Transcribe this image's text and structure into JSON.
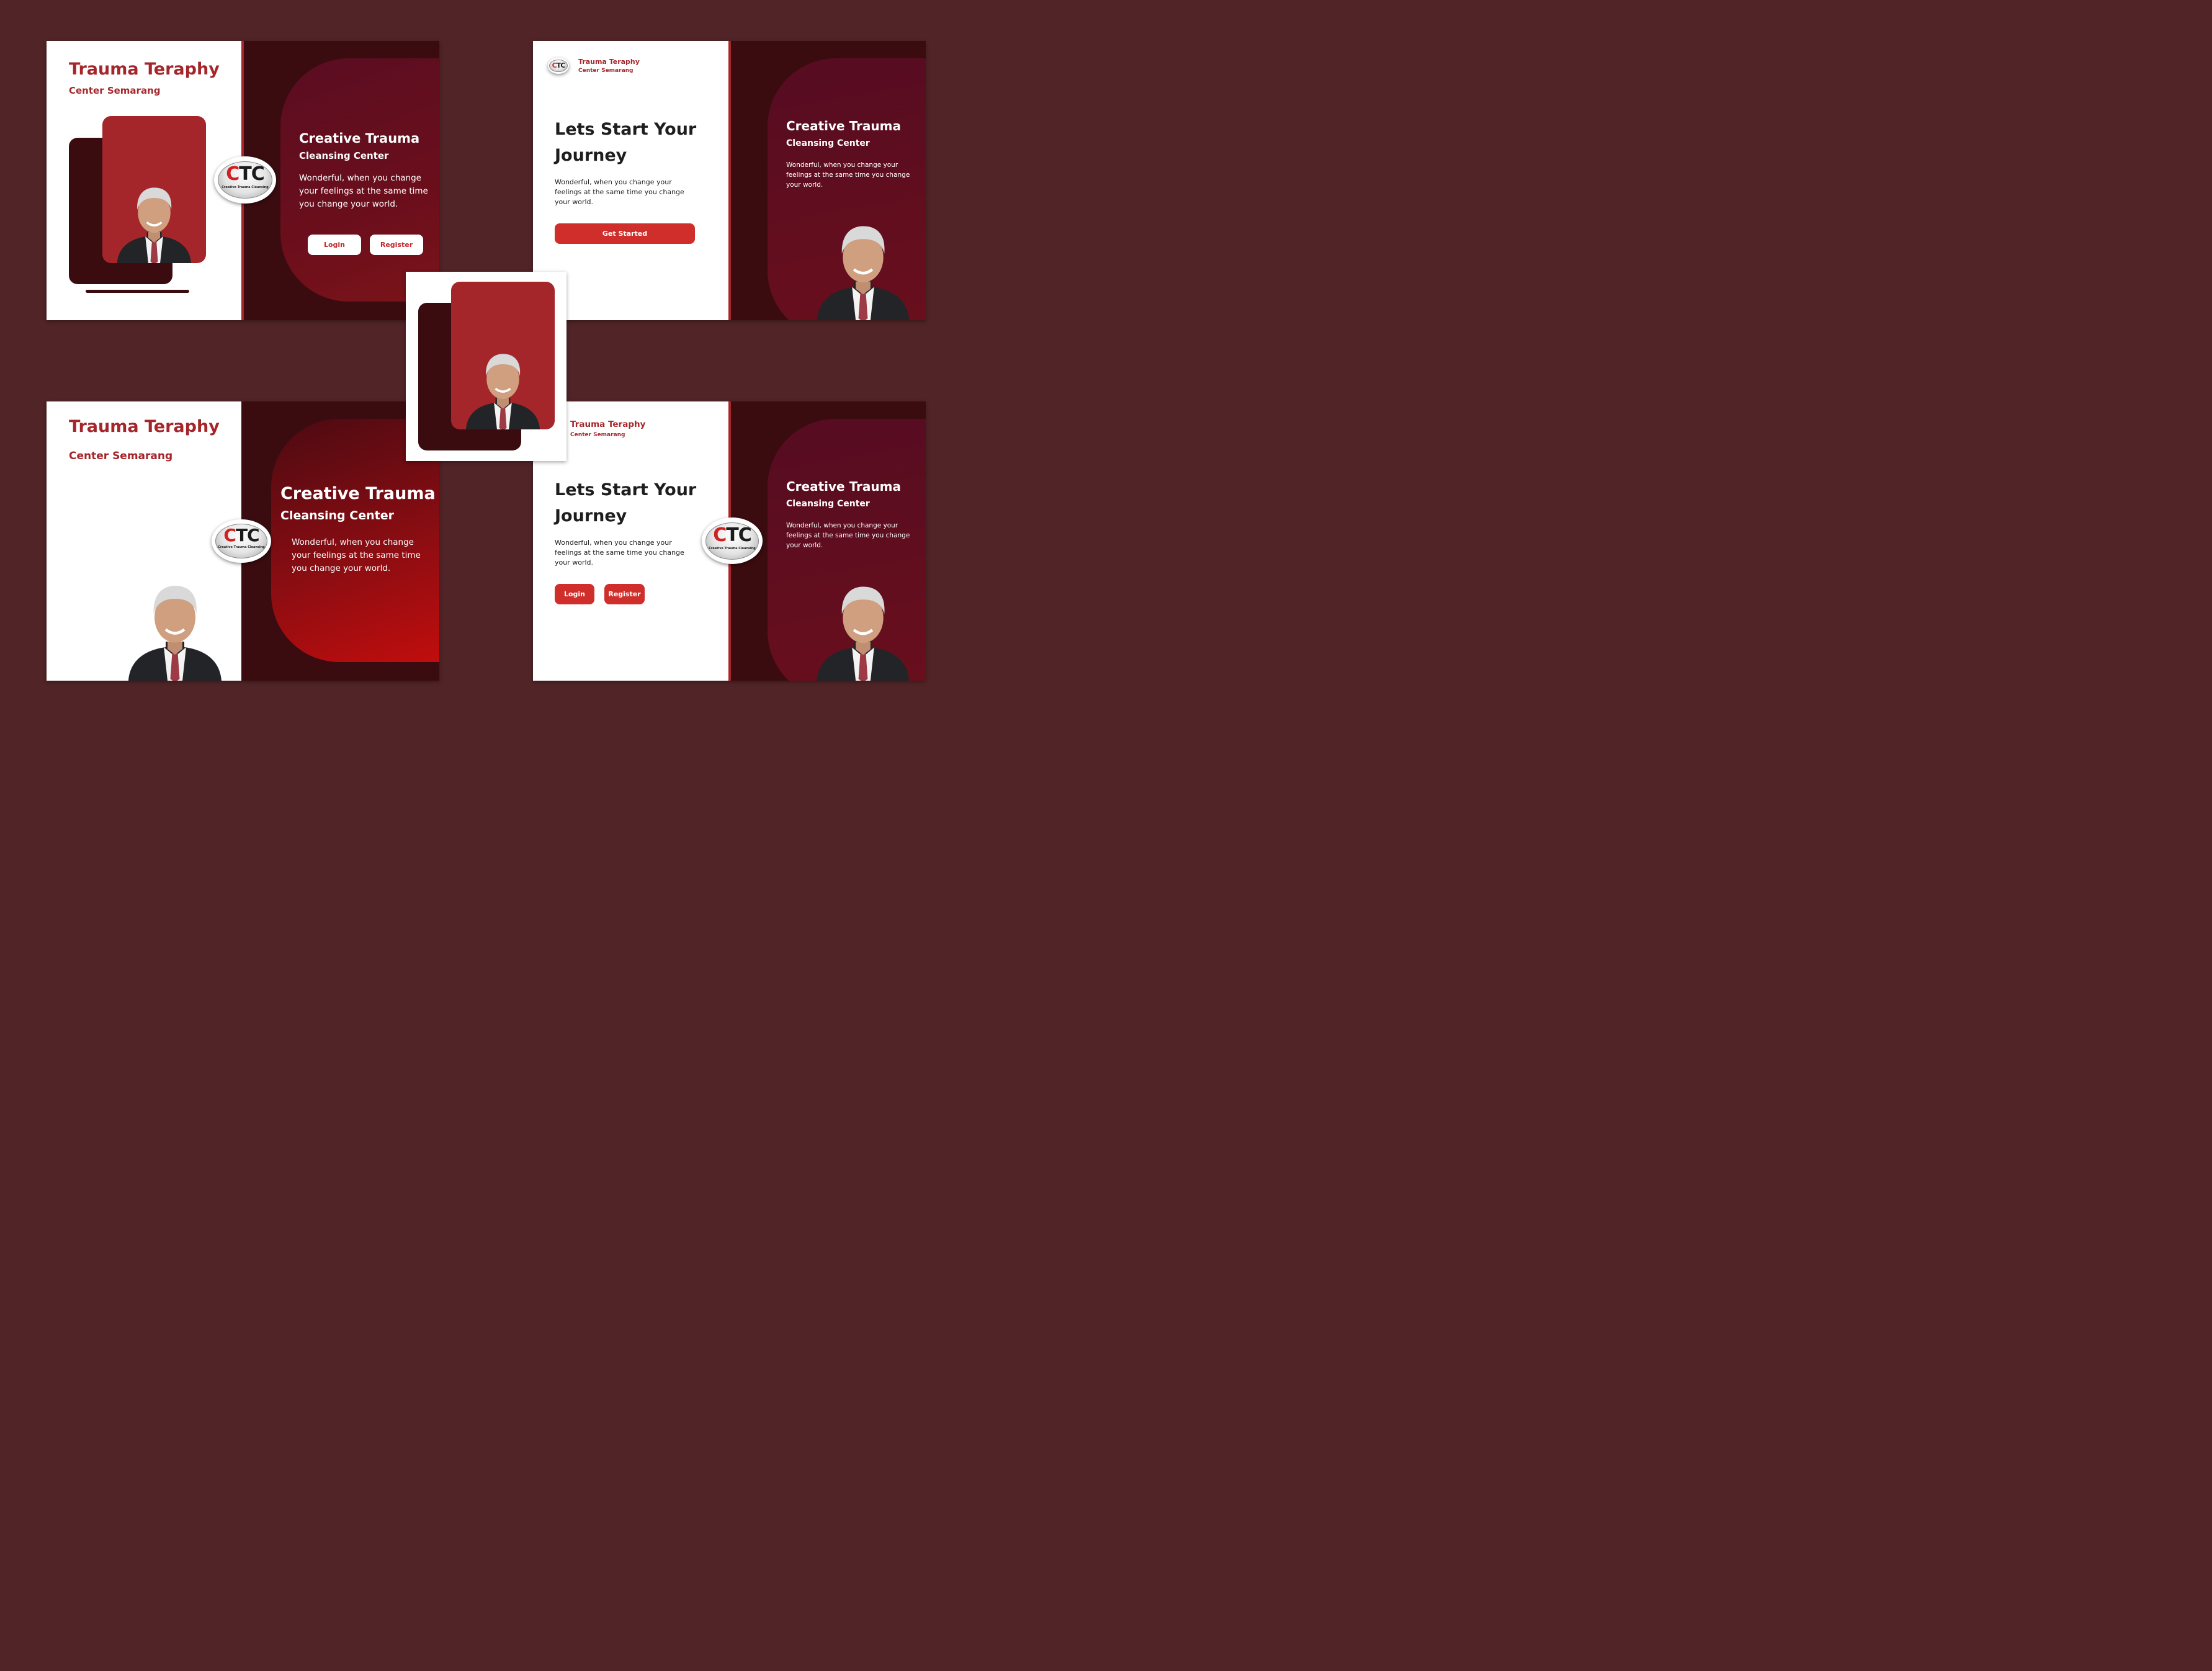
{
  "brand": {
    "title": "Trauma Teraphy",
    "subtitle": "Center Semarang",
    "logo_text": "CTC",
    "logo_caption": "Creative Trauma Cleansing"
  },
  "hero": {
    "heading_line1": "Creative Trauma",
    "heading_line2": "Cleansing Center",
    "description": "Wonderful, when you change your feelings at the same time you change your world."
  },
  "onboarding": {
    "heading": "Lets Start Your Journey",
    "description": "Wonderful, when you change your feelings at the same time you change your world.",
    "get_started_label": "Get Started"
  },
  "auth": {
    "login_label": "Login",
    "register_label": "Register"
  },
  "icons": [
    "ctc-logo-icon",
    "person-photo"
  ],
  "colors": {
    "background": "#512427",
    "brand_red": "#a5262a",
    "button_red": "#d02e2b",
    "dark_panel": "#3a0c10"
  }
}
